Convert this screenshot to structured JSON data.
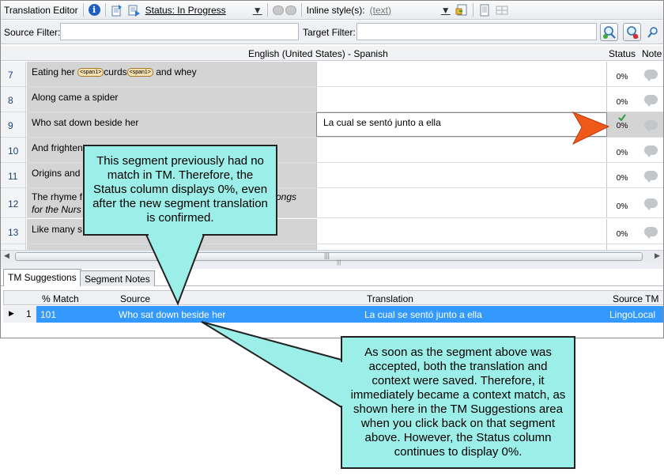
{
  "toolbar": {
    "title": "Translation Editor",
    "status_value": "Status: In Progress",
    "inline_label": "Inline style(s):",
    "inline_value": "(text)"
  },
  "filters": {
    "source_label": "Source Filter:",
    "target_label": "Target Filter:"
  },
  "grid": {
    "language_header": "English (United States) - Spanish",
    "status_header": "Status",
    "notes_header": "Note",
    "rows": [
      {
        "num": "7",
        "source_parts": [
          "Eating her ",
          "<span1>",
          "curds",
          "<span1>",
          " and whey"
        ],
        "target": "",
        "status": "0%"
      },
      {
        "num": "8",
        "source": "Along came a spider",
        "target": "",
        "status": "0%"
      },
      {
        "num": "9",
        "source": "Who sat down beside her",
        "target": "La cual se sentó junto a ella",
        "status": "0%"
      },
      {
        "num": "10",
        "source": "And frighten",
        "target": "",
        "status": "0%"
      },
      {
        "num": "11",
        "source": "Origins and",
        "target": "",
        "status": "0%"
      },
      {
        "num": "12",
        "source_a": "The rhyme f",
        "source_b": "Songs",
        "source_c": "for the Nurs",
        "target": "",
        "status": "0%"
      },
      {
        "num": "13",
        "source": "Like many s",
        "target": "",
        "status": "0%"
      }
    ]
  },
  "bottom": {
    "tabs": [
      "TM Suggestions",
      "Segment Notes"
    ],
    "columns": [
      "% Match",
      "Source",
      "Translation",
      "Source TM"
    ],
    "row": {
      "index": "1",
      "match": "101",
      "source": "Who sat down beside her",
      "translation": "La cual se sentó junto a ella",
      "source_tm": "LingoLocal"
    }
  },
  "callouts": {
    "top": "This segment previously had no match in TM. Therefore, the Status column displays 0%, even after the new segment translation is confirmed.",
    "bottom": "As soon as the segment above was accepted, both the translation and context were saved. Therefore, it immediately became a context match, as shown here in the TM Suggestions area when you click back on that segment above. However, the Status column continues to display 0%."
  },
  "colors": {
    "callout_fill": "#9ceee8",
    "arrow": "#ef5a1a",
    "selection": "#3399ff",
    "check": "#2e9e3e"
  }
}
